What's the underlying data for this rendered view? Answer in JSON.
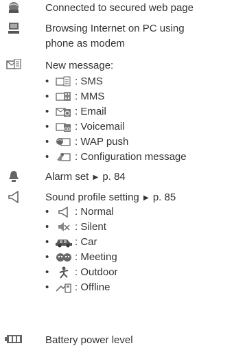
{
  "entries": [
    {
      "icon": "globe-lock-icon",
      "text": "Connected to secured web page"
    },
    {
      "icon": "pc-modem-icon",
      "text_lines": [
        "Browsing Internet on PC using",
        "phone as modem"
      ]
    },
    {
      "icon": "new-message-icon",
      "text": "New message:",
      "sub": [
        {
          "icon": "sms-icon",
          "label": ": SMS"
        },
        {
          "icon": "mms-icon",
          "label": ": MMS"
        },
        {
          "icon": "email-icon",
          "label": ": Email"
        },
        {
          "icon": "voicemail-icon",
          "label": ": Voicemail"
        },
        {
          "icon": "wap-push-icon",
          "label": ": WAP push"
        },
        {
          "icon": "configuration-message-icon",
          "label": ": Configuration message"
        }
      ]
    },
    {
      "icon": "alarm-bell-icon",
      "text": "Alarm set",
      "ref": "p. 84"
    },
    {
      "icon": "speaker-icon",
      "text": "Sound profile setting",
      "ref": "p. 85",
      "sub": [
        {
          "icon": "normal-speaker-icon",
          "label": ": Normal"
        },
        {
          "icon": "silent-speaker-icon",
          "label": ": Silent"
        },
        {
          "icon": "car-icon",
          "label": ": Car"
        },
        {
          "icon": "meeting-icon",
          "label": ": Meeting"
        },
        {
          "icon": "outdoor-icon",
          "label": ": Outdoor"
        },
        {
          "icon": "offline-icon",
          "label": ": Offline"
        }
      ]
    },
    {
      "icon": "battery-icon",
      "text": "Battery power level"
    }
  ],
  "bullet_char": "•",
  "ref_arrow": "▶",
  "colors": {
    "text": "#333333",
    "icon": "#555555",
    "icon_light": "#999999"
  }
}
